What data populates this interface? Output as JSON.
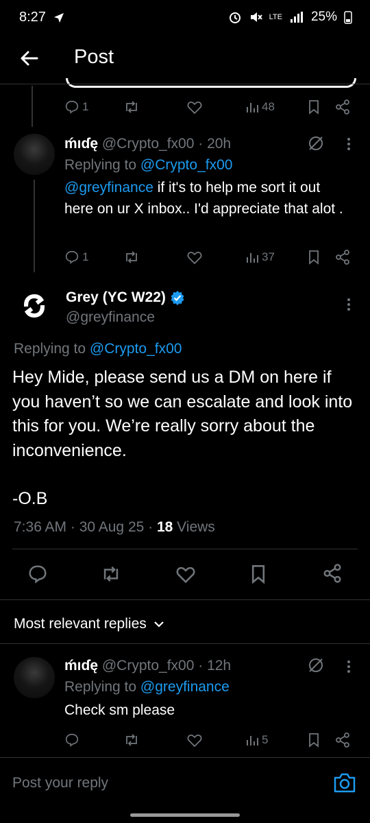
{
  "status_bar": {
    "time": "8:27",
    "battery": "25%",
    "network": "LTE"
  },
  "header": {
    "title": "Post"
  },
  "reply_1": {
    "counts": {
      "reply": "1",
      "views": "48"
    }
  },
  "reply_2": {
    "display_name": "ḿıɗę",
    "handle": "@Crypto_fx00",
    "time": "· 20h",
    "replying_label": "Replying to",
    "replying_handle": "@Crypto_fx00",
    "mention": "@greyfinance",
    "text": " if it's to help me sort it out here on ur X inbox.. I'd appreciate that alot .",
    "counts": {
      "reply": "1",
      "views": "37"
    }
  },
  "main_post": {
    "display_name": "Grey (YC W22)",
    "handle": "@greyfinance",
    "replying_label": "Replying to",
    "replying_handle": "@Crypto_fx00",
    "body": "Hey Mide, please send us a DM on here if you haven’t so we can escalate and look into this for you. We’re really sorry about the inconvenience.",
    "signature": "-O.B",
    "meta_time": "7:36 AM · 30 Aug 25 · ",
    "views_count": "18",
    "views_label": " Views"
  },
  "sort": {
    "label": "Most relevant replies"
  },
  "reply_3": {
    "display_name": "ḿıɗę",
    "handle": "@Crypto_fx00",
    "time": "· 12h",
    "replying_label": "Replying to",
    "replying_handle": "@greyfinance",
    "text": "Check sm please",
    "counts": {
      "views": "5"
    }
  },
  "composer": {
    "placeholder": "Post your reply"
  },
  "colors": {
    "accent": "#1d9bf0",
    "muted": "#71767b",
    "background": "#000000",
    "divider": "#2f3336"
  }
}
